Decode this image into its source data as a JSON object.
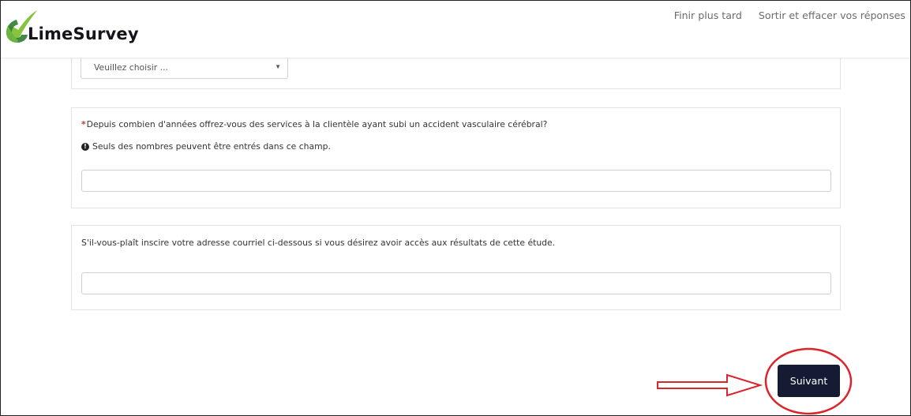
{
  "header": {
    "brand_name": "LimeSurvey",
    "links": {
      "finish_later": "Finir plus tard",
      "exit_clear": "Sortir et effacer vos réponses"
    }
  },
  "questions": {
    "select": {
      "placeholder": "Veuillez choisir ..."
    },
    "years": {
      "required_marker": "*",
      "text": "Depuis combien d'années offrez-vous des services à la clientèle ayant subi un accident vasculaire cérébral?",
      "help_icon": "info-circle-icon",
      "help": "Seuls des nombres peuvent être entrés dans ce champ.",
      "value": ""
    },
    "email": {
      "text": "S'il-vous-plaît inscire votre adresse courriel ci-dessous si vous désirez avoir accès aux résultats de cette étude.",
      "value": ""
    }
  },
  "navigation": {
    "next_label": "Suivant"
  },
  "colors": {
    "brand_green": "#7ac142",
    "button": "#141b33",
    "annotation_red": "#d9262b",
    "required_red": "#c0392b"
  }
}
